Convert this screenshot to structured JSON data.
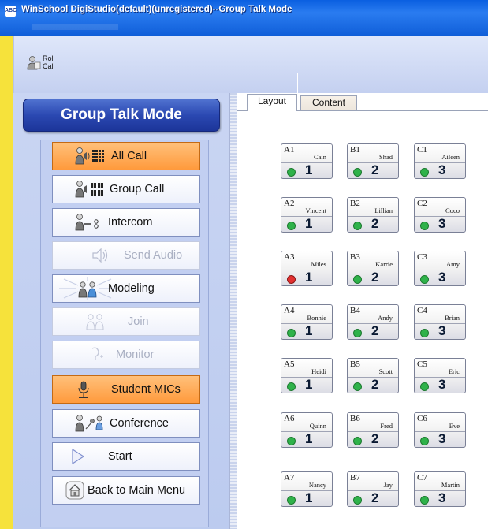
{
  "window": {
    "title": "WinSchool DigiStudio(default)(unregistered)--Group Talk Mode",
    "app_icon_text": "ABC"
  },
  "toolbar": {
    "roll_call_line1": "Roll",
    "roll_call_line2": "Call"
  },
  "sidebar": {
    "header": "Group Talk Mode",
    "buttons": [
      {
        "label": "All Call",
        "state": "active"
      },
      {
        "label": "Group Call",
        "state": "normal"
      },
      {
        "label": "Intercom",
        "state": "normal"
      },
      {
        "label": "Send Audio",
        "state": "disabled"
      },
      {
        "label": "Modeling",
        "state": "normal"
      },
      {
        "label": "Join",
        "state": "disabled"
      },
      {
        "label": "Monitor",
        "state": "disabled"
      },
      {
        "label": "Student MICs",
        "state": "active"
      },
      {
        "label": "Conference",
        "state": "normal"
      },
      {
        "label": "Start",
        "state": "normal"
      },
      {
        "label": "Back to Main Menu",
        "state": "normal"
      }
    ]
  },
  "tabs": [
    {
      "label": "Layout",
      "active": true
    },
    {
      "label": "Content",
      "active": false
    }
  ],
  "students": [
    {
      "id": "A1",
      "name": "Cain",
      "group": "1",
      "status": "green"
    },
    {
      "id": "B1",
      "name": "Shad",
      "group": "2",
      "status": "green"
    },
    {
      "id": "C1",
      "name": "Aileen",
      "group": "3",
      "status": "green"
    },
    {
      "id": "A2",
      "name": "Vincent",
      "group": "1",
      "status": "green"
    },
    {
      "id": "B2",
      "name": "Lillian",
      "group": "2",
      "status": "green"
    },
    {
      "id": "C2",
      "name": "Coco",
      "group": "3",
      "status": "green"
    },
    {
      "id": "A3",
      "name": "Miles",
      "group": "1",
      "status": "red"
    },
    {
      "id": "B3",
      "name": "Karrie",
      "group": "2",
      "status": "green"
    },
    {
      "id": "C3",
      "name": "Amy",
      "group": "3",
      "status": "green"
    },
    {
      "id": "A4",
      "name": "Bonnie",
      "group": "1",
      "status": "green"
    },
    {
      "id": "B4",
      "name": "Andy",
      "group": "2",
      "status": "green"
    },
    {
      "id": "C4",
      "name": "Brian",
      "group": "3",
      "status": "green"
    },
    {
      "id": "A5",
      "name": "Heidi",
      "group": "1",
      "status": "green"
    },
    {
      "id": "B5",
      "name": "Scott",
      "group": "2",
      "status": "green"
    },
    {
      "id": "C5",
      "name": "Eric",
      "group": "3",
      "status": "green"
    },
    {
      "id": "A6",
      "name": "Quinn",
      "group": "1",
      "status": "green"
    },
    {
      "id": "B6",
      "name": "Fred",
      "group": "2",
      "status": "green"
    },
    {
      "id": "C6",
      "name": "Eve",
      "group": "3",
      "status": "green"
    },
    {
      "id": "A7",
      "name": "Nancy",
      "group": "1",
      "status": "green"
    },
    {
      "id": "B7",
      "name": "Jay",
      "group": "2",
      "status": "green"
    },
    {
      "id": "C7",
      "name": "Martin",
      "group": "3",
      "status": "green"
    }
  ],
  "colors": {
    "titlebar": "#0f5ed8",
    "active_button": "#ff9a3c",
    "status_on": "#2fb24a",
    "status_alert": "#e23030",
    "desktop": "#f6e23b"
  }
}
